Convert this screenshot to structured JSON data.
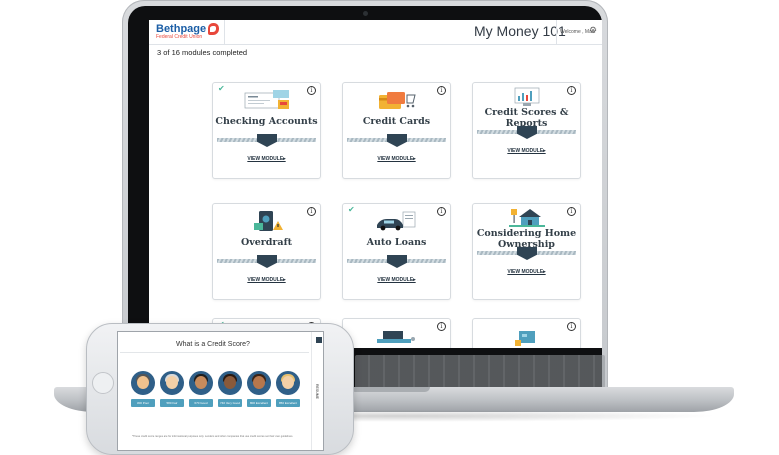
{
  "brand": {
    "name": "Bethpage",
    "subtitle": "Federal Credit Union",
    "accent": "#e8473b",
    "primary": "#1b5ea6"
  },
  "header": {
    "title": "My Money 101",
    "welcome": "Welcome , Matt",
    "settings_icon": "gear-icon"
  },
  "progress": {
    "text": "3 of 16 modules completed",
    "completed": 3,
    "total": 16
  },
  "modules": [
    {
      "title": "Checking Accounts",
      "link": "VIEW MODULE▸",
      "completed": true,
      "icon": "checking-illustration"
    },
    {
      "title": "Credit Cards",
      "link": "VIEW MODULE▸",
      "completed": false,
      "icon": "credit-card-illustration"
    },
    {
      "title": "Credit Scores & Reports",
      "link": "VIEW MODULE▸",
      "completed": false,
      "icon": "credit-report-illustration"
    },
    {
      "title": "Overdraft",
      "link": "VIEW MODULE▸",
      "completed": false,
      "icon": "overdraft-illustration"
    },
    {
      "title": "Auto Loans",
      "link": "VIEW MODULE▸",
      "completed": true,
      "icon": "car-illustration"
    },
    {
      "title": "Considering Home Ownership",
      "link": "VIEW MODULE▸",
      "completed": false,
      "icon": "house-illustration"
    },
    {
      "title": "",
      "completed": true,
      "icon": "module-7-illustration"
    },
    {
      "title": "",
      "completed": false,
      "icon": "module-8-illustration"
    },
    {
      "title": "",
      "completed": false,
      "icon": "module-9-illustration"
    }
  ],
  "phone": {
    "title": "What is a Credit Score?",
    "side_label": "RESUME",
    "scores": [
      "300 Poor",
      "580 Fair",
      "670 Good",
      "740 Very Good",
      "800 Excellent",
      "850 Excellent"
    ],
    "footnote": "*These credit score ranges are for informational purposes only. Lenders and other companies that use credit scores set their own guidelines.",
    "face_colors": [
      "#f0a35e",
      "#d9d9d9",
      "#7a4a2c",
      "#6b3d23",
      "#f0a35e",
      "#f3c58b"
    ]
  }
}
